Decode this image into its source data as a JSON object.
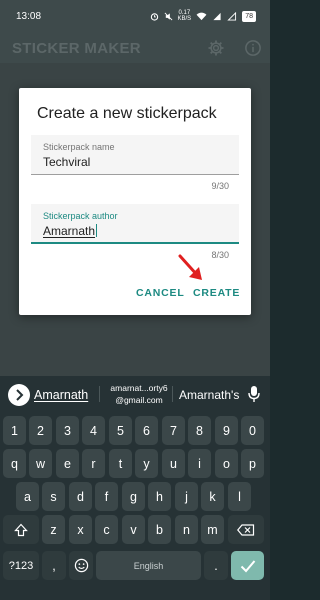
{
  "status": {
    "time": "13:08",
    "speed_value": "0.17",
    "speed_unit": "KB/S",
    "battery": "78"
  },
  "app_bar": {
    "title": "STICKER MAKER"
  },
  "dialog": {
    "title": "Create a new stickerpack",
    "name_field": {
      "label": "Stickerpack name",
      "value": "Techviral",
      "counter": "9/30"
    },
    "author_field": {
      "label": "Stickerpack author",
      "value": "Amarnath",
      "counter": "8/30"
    },
    "cancel_label": "CANCEL",
    "create_label": "CREATE"
  },
  "keyboard": {
    "suggestions": {
      "first": "Amarnath",
      "middle_line1": "amarnat...orty6",
      "middle_line2": "@gmail.com",
      "last": "Amarnath's"
    },
    "row1": [
      "1",
      "2",
      "3",
      "4",
      "5",
      "6",
      "7",
      "8",
      "9",
      "0"
    ],
    "row2": [
      "q",
      "w",
      "e",
      "r",
      "t",
      "y",
      "u",
      "i",
      "o",
      "p"
    ],
    "row3": [
      "a",
      "s",
      "d",
      "f",
      "g",
      "h",
      "j",
      "k",
      "l"
    ],
    "row4": [
      "z",
      "x",
      "c",
      "v",
      "b",
      "n",
      "m"
    ],
    "symbols_label": "?123",
    "comma_label": ",",
    "space_label": "English",
    "period_label": "."
  },
  "colors": {
    "accent": "#1d8a82",
    "arrow": "#e02020",
    "enter_key": "#7fb9ad"
  }
}
